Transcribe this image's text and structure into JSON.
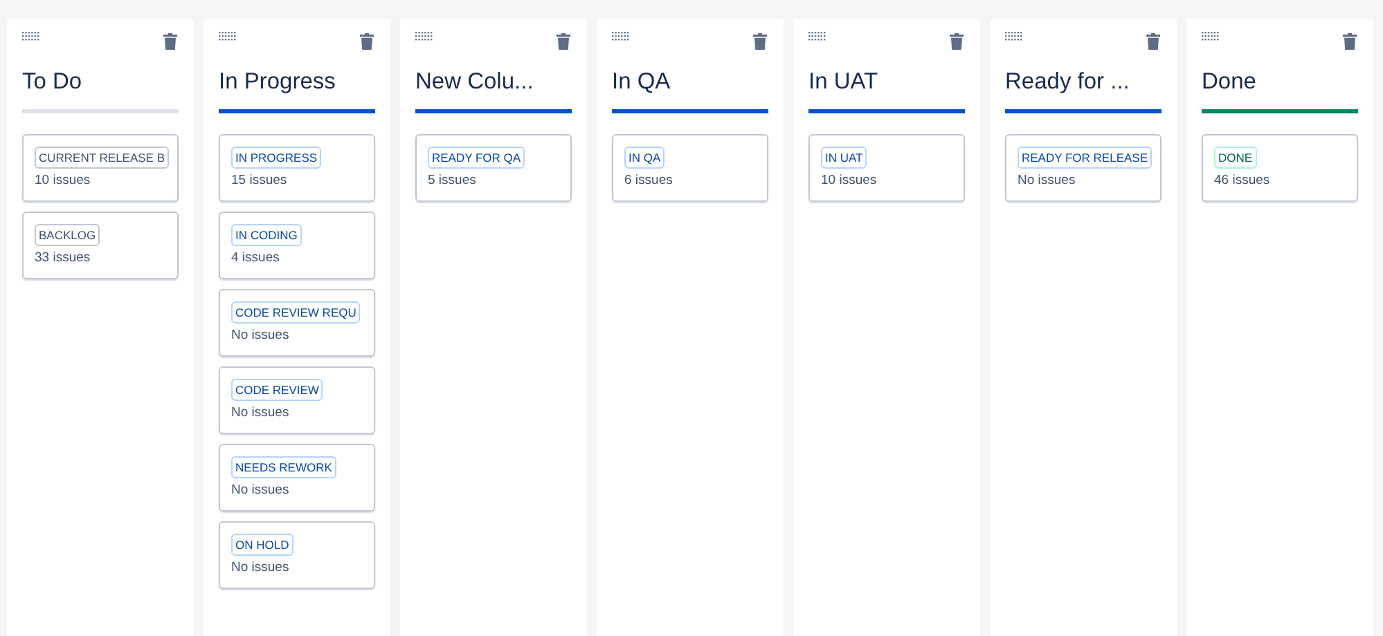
{
  "columns": [
    {
      "title": "To Do",
      "color": "#dfe1e6",
      "statuses": [
        {
          "name": "CURRENT RELEASE B",
          "count": "10 issues"
        },
        {
          "name": "BACKLOG",
          "count": "33 issues"
        }
      ]
    },
    {
      "title": "In Progress",
      "color": "#0052cc",
      "statuses": [
        {
          "name": "IN PROGRESS",
          "count": "15 issues"
        },
        {
          "name": "IN CODING",
          "count": "4 issues"
        },
        {
          "name": "CODE REVIEW REQU",
          "count": "No issues"
        },
        {
          "name": "CODE REVIEW",
          "count": "No issues"
        },
        {
          "name": "NEEDS REWORK",
          "count": "No issues"
        },
        {
          "name": "ON HOLD",
          "count": "No issues"
        }
      ]
    },
    {
      "title": "New Colu...",
      "color": "#0052cc",
      "statuses": [
        {
          "name": "READY FOR QA",
          "count": "5 issues"
        }
      ]
    },
    {
      "title": "In QA",
      "color": "#0052cc",
      "statuses": [
        {
          "name": "IN QA",
          "count": "6 issues"
        }
      ]
    },
    {
      "title": "In UAT",
      "color": "#0052cc",
      "statuses": [
        {
          "name": "IN UAT",
          "count": "10 issues"
        }
      ]
    },
    {
      "title": "Ready for ...",
      "color": "#0052cc",
      "statuses": [
        {
          "name": "READY FOR RELEASE",
          "count": "No issues"
        }
      ]
    },
    {
      "title": "Done",
      "color": "#00875a",
      "statuses": [
        {
          "name": "DONE",
          "count": "46 issues"
        }
      ]
    }
  ]
}
